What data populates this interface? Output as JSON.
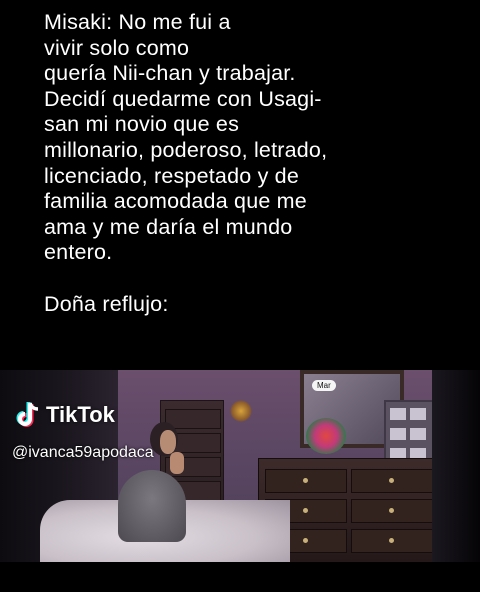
{
  "caption": {
    "lines": [
      "Misaki: No me fui a",
      "vivir solo como",
      "quería Nii-chan y trabajar.",
      "Decidí quedarme con Usagi-",
      "san mi novio que es",
      "millonario, poderoso, letrado,",
      "licenciado, respetado y de",
      "familia acomodada que me",
      "ama y me daría el mundo",
      "entero."
    ],
    "punchline": "Doña reflujo:"
  },
  "video": {
    "tiktok_brand": "TikTok",
    "handle": "@ivanca59apodaca",
    "badge": "Mar",
    "logo_icon": "tiktok-note-icon",
    "colors": {
      "brand_cyan": "#25F4EE",
      "brand_red": "#FE2C55"
    }
  }
}
